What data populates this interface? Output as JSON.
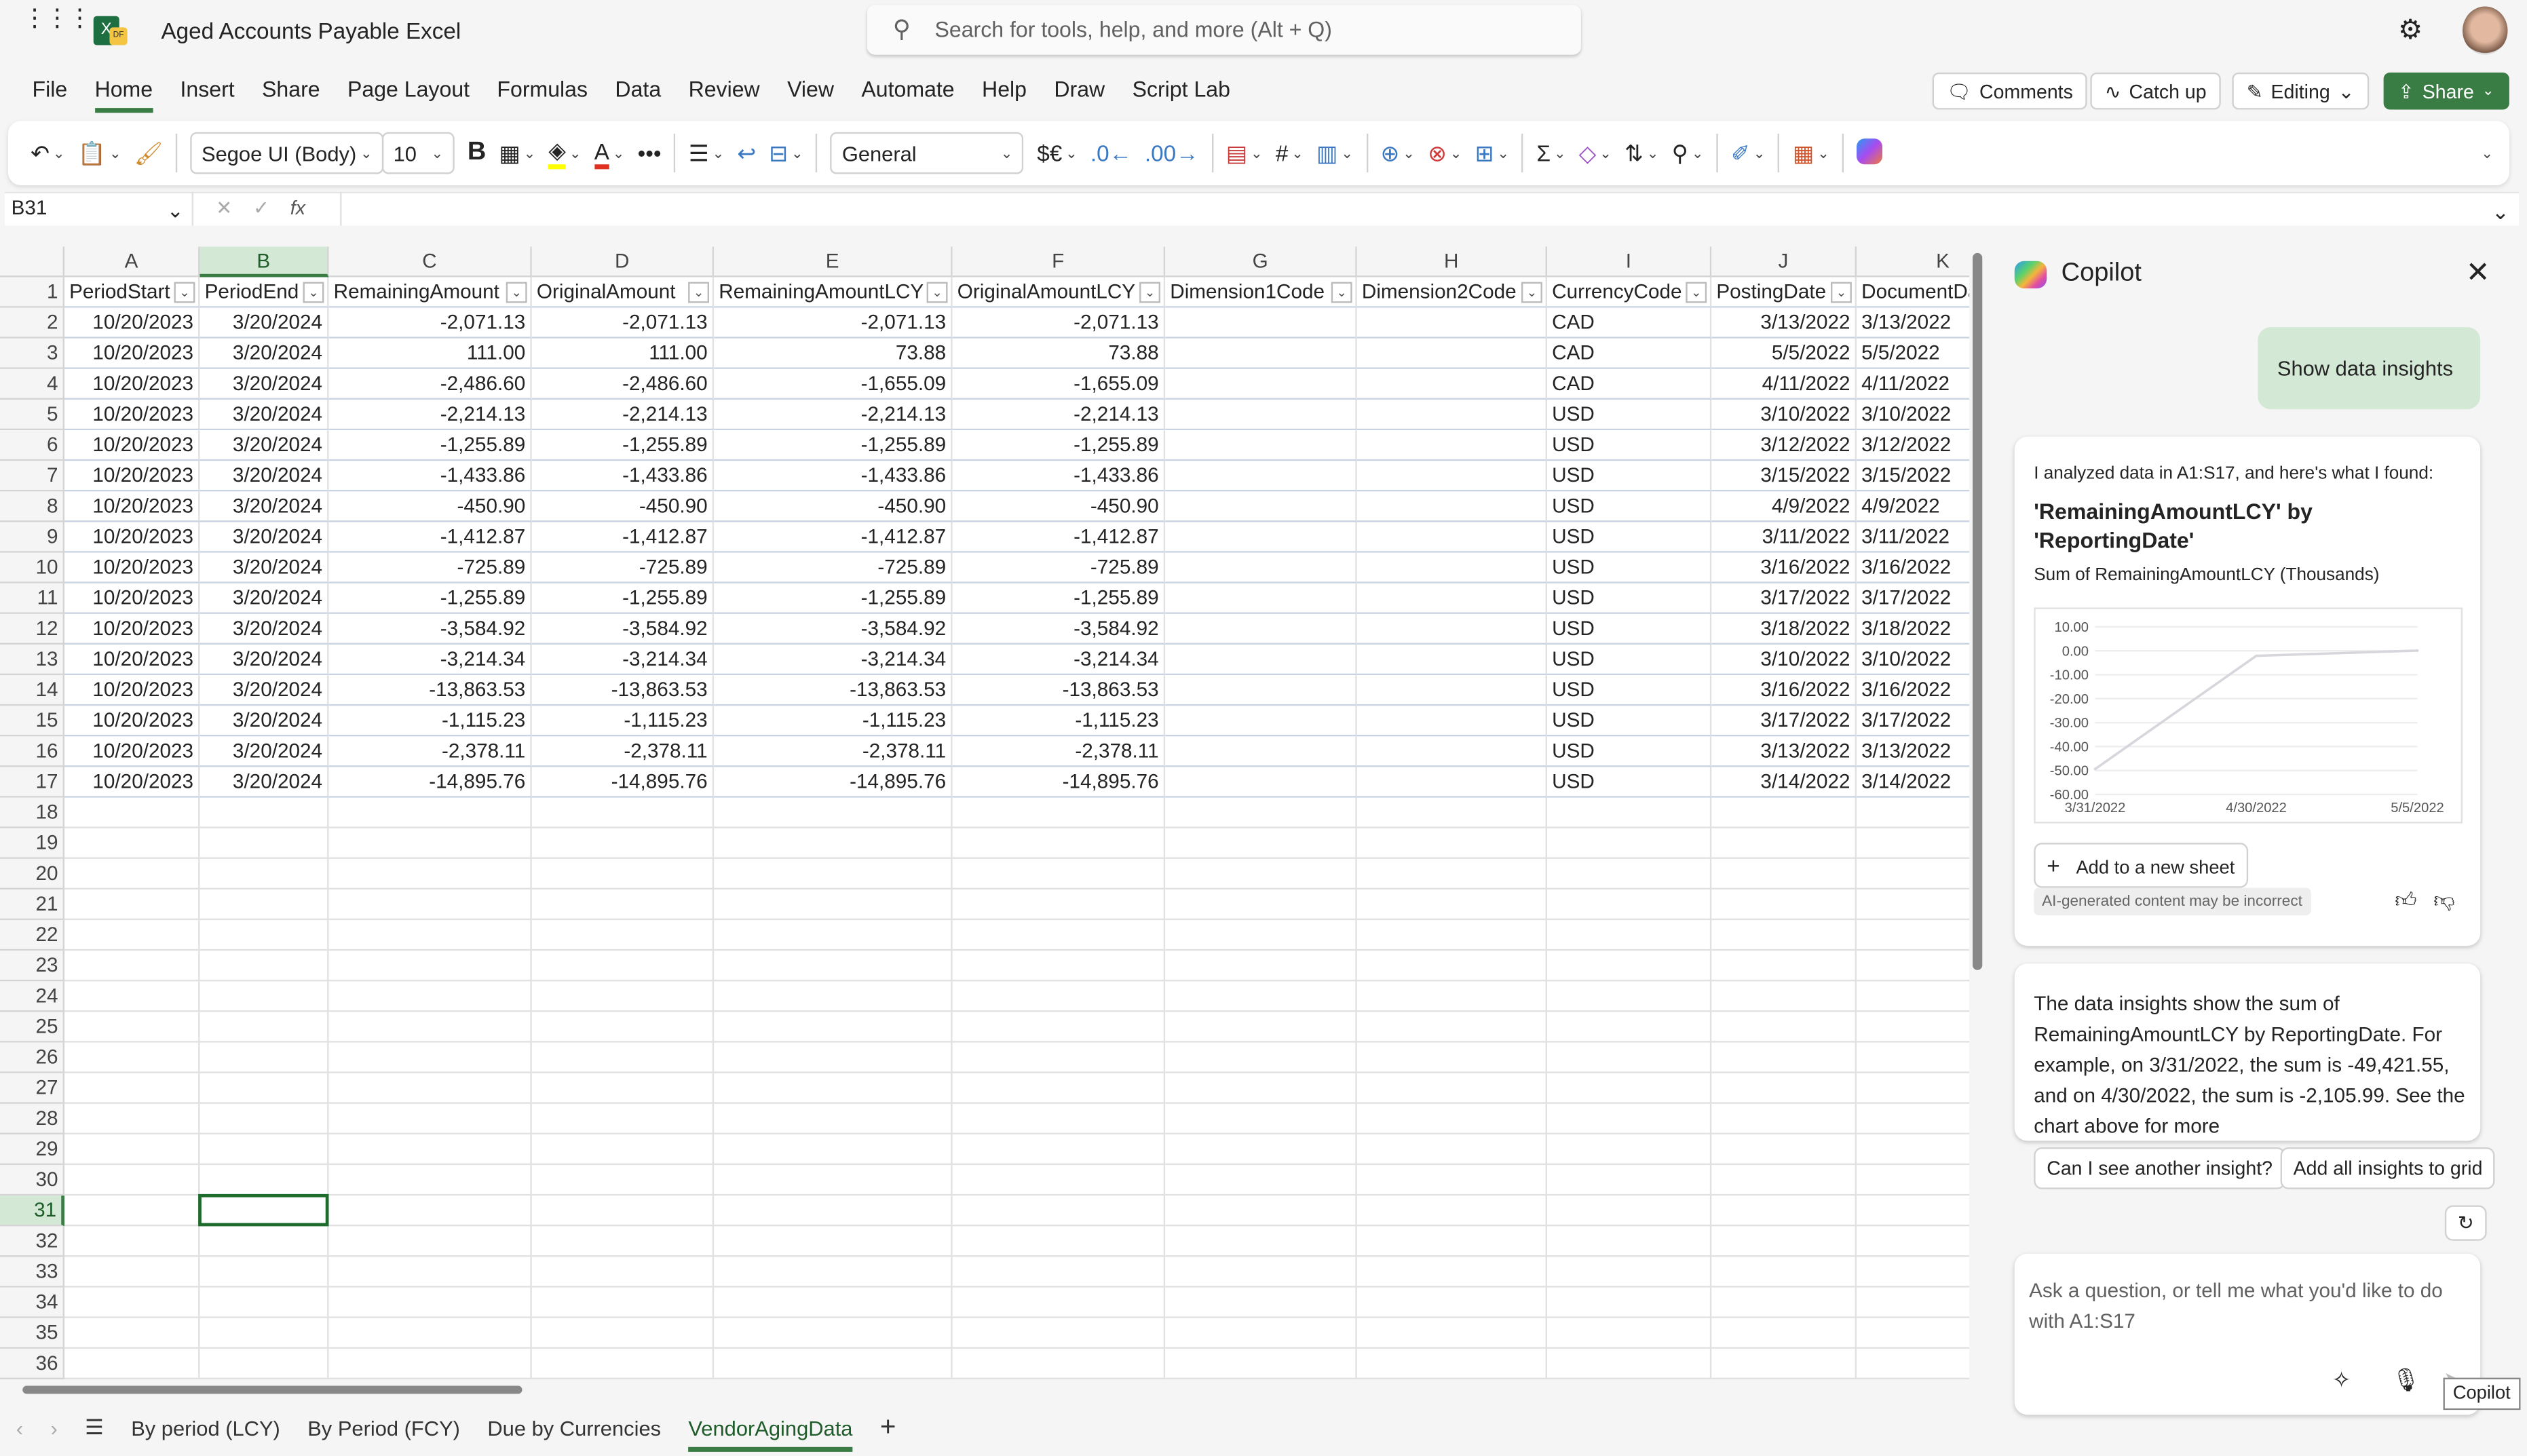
{
  "app": {
    "title": "Aged Accounts Payable Excel",
    "search_placeholder": "Search for tools, help, and more (Alt + Q)",
    "icons": [
      "app-launcher-icon",
      "excel-logo-icon",
      "search-icon",
      "gear-icon",
      "avatar"
    ],
    "accent": "#3a7d44"
  },
  "menu": [
    "File",
    "Home",
    "Insert",
    "Share",
    "Page Layout",
    "Formulas",
    "Data",
    "Review",
    "View",
    "Automate",
    "Help",
    "Draw",
    "Script Lab"
  ],
  "menu_active": "Home",
  "actions": {
    "comments": "Comments",
    "catchup": "Catch up",
    "editing": "Editing",
    "share": "Share"
  },
  "ribbon": {
    "font": "Segoe UI (Body)",
    "size": "10",
    "bold": "B",
    "number_format": "General",
    "currency": "$€",
    "more": "•••"
  },
  "formula_bar": {
    "name_box": "B31",
    "fx": "fx",
    "value": ""
  },
  "sheet": {
    "columns": [
      "A",
      "B",
      "C",
      "D",
      "E",
      "F",
      "G",
      "H",
      "I",
      "J",
      "K"
    ],
    "selected_column": "B",
    "selected_row": 31,
    "selected_cell": "B31",
    "headers": [
      "PeriodStart",
      "PeriodEnd",
      "RemainingAmount",
      "OriginalAmount",
      "RemainingAmountLCY",
      "OriginalAmountLCY",
      "Dimension1Code",
      "Dimension2Code",
      "CurrencyCode",
      "PostingDate",
      "DocumentDate"
    ],
    "rows": [
      [
        "10/20/2023",
        "3/20/2024",
        "-2,071.13",
        "-2,071.13",
        "-2,071.13",
        "-2,071.13",
        "",
        "",
        "CAD",
        "3/13/2022",
        "3/13/2022"
      ],
      [
        "10/20/2023",
        "3/20/2024",
        "111.00",
        "111.00",
        "73.88",
        "73.88",
        "",
        "",
        "CAD",
        "5/5/2022",
        "5/5/2022"
      ],
      [
        "10/20/2023",
        "3/20/2024",
        "-2,486.60",
        "-2,486.60",
        "-1,655.09",
        "-1,655.09",
        "",
        "",
        "CAD",
        "4/11/2022",
        "4/11/2022"
      ],
      [
        "10/20/2023",
        "3/20/2024",
        "-2,214.13",
        "-2,214.13",
        "-2,214.13",
        "-2,214.13",
        "",
        "",
        "USD",
        "3/10/2022",
        "3/10/2022"
      ],
      [
        "10/20/2023",
        "3/20/2024",
        "-1,255.89",
        "-1,255.89",
        "-1,255.89",
        "-1,255.89",
        "",
        "",
        "USD",
        "3/12/2022",
        "3/12/2022"
      ],
      [
        "10/20/2023",
        "3/20/2024",
        "-1,433.86",
        "-1,433.86",
        "-1,433.86",
        "-1,433.86",
        "",
        "",
        "USD",
        "3/15/2022",
        "3/15/2022"
      ],
      [
        "10/20/2023",
        "3/20/2024",
        "-450.90",
        "-450.90",
        "-450.90",
        "-450.90",
        "",
        "",
        "USD",
        "4/9/2022",
        "4/9/2022"
      ],
      [
        "10/20/2023",
        "3/20/2024",
        "-1,412.87",
        "-1,412.87",
        "-1,412.87",
        "-1,412.87",
        "",
        "",
        "USD",
        "3/11/2022",
        "3/11/2022"
      ],
      [
        "10/20/2023",
        "3/20/2024",
        "-725.89",
        "-725.89",
        "-725.89",
        "-725.89",
        "",
        "",
        "USD",
        "3/16/2022",
        "3/16/2022"
      ],
      [
        "10/20/2023",
        "3/20/2024",
        "-1,255.89",
        "-1,255.89",
        "-1,255.89",
        "-1,255.89",
        "",
        "",
        "USD",
        "3/17/2022",
        "3/17/2022"
      ],
      [
        "10/20/2023",
        "3/20/2024",
        "-3,584.92",
        "-3,584.92",
        "-3,584.92",
        "-3,584.92",
        "",
        "",
        "USD",
        "3/18/2022",
        "3/18/2022"
      ],
      [
        "10/20/2023",
        "3/20/2024",
        "-3,214.34",
        "-3,214.34",
        "-3,214.34",
        "-3,214.34",
        "",
        "",
        "USD",
        "3/10/2022",
        "3/10/2022"
      ],
      [
        "10/20/2023",
        "3/20/2024",
        "-13,863.53",
        "-13,863.53",
        "-13,863.53",
        "-13,863.53",
        "",
        "",
        "USD",
        "3/16/2022",
        "3/16/2022"
      ],
      [
        "10/20/2023",
        "3/20/2024",
        "-1,115.23",
        "-1,115.23",
        "-1,115.23",
        "-1,115.23",
        "",
        "",
        "USD",
        "3/17/2022",
        "3/17/2022"
      ],
      [
        "10/20/2023",
        "3/20/2024",
        "-2,378.11",
        "-2,378.11",
        "-2,378.11",
        "-2,378.11",
        "",
        "",
        "USD",
        "3/13/2022",
        "3/13/2022"
      ],
      [
        "10/20/2023",
        "3/20/2024",
        "-14,895.76",
        "-14,895.76",
        "-14,895.76",
        "-14,895.76",
        "",
        "",
        "USD",
        "3/14/2022",
        "3/14/2022"
      ]
    ]
  },
  "tabs": [
    "By period (LCY)",
    "By Period (FCY)",
    "Due by Currencies",
    "VendorAgingData"
  ],
  "active_tab": "VendorAgingData",
  "copilot": {
    "title": "Copilot",
    "user_msg": "Show data insights",
    "intro": "I analyzed data in A1:S17, and here's what I found:",
    "insight_title": "'RemainingAmountLCY' by 'ReportingDate'",
    "subtitle": "Sum of RemainingAmountLCY (Thousands)",
    "add_sheet": "Add to a new sheet",
    "disclaimer": "AI-generated content may be incorrect",
    "summary": "The data insights show the sum of RemainingAmountLCY by ReportingDate. For example, on 3/31/2022, the sum is -49,421.55, and on 4/30/2022, the sum is -2,105.99. See the chart above for more",
    "suggestions": [
      "Can I see another insight?",
      "Add all insights to grid"
    ],
    "input_placeholder": "Ask a question, or tell me what you'd like to do with A1:S17",
    "tooltip": "Copilot"
  },
  "chart_data": {
    "type": "line",
    "x": [
      "3/31/2022",
      "4/30/2022",
      "5/5/2022"
    ],
    "values": [
      -49.42,
      -2.11,
      0.07
    ],
    "yticks": [
      "10.00",
      "0.00",
      "-10.00",
      "-20.00",
      "-30.00",
      "-40.00",
      "-50.00",
      "-60.00"
    ],
    "ylim": [
      -60,
      10
    ],
    "grid": true,
    "line_color": "#d6d6dc"
  }
}
